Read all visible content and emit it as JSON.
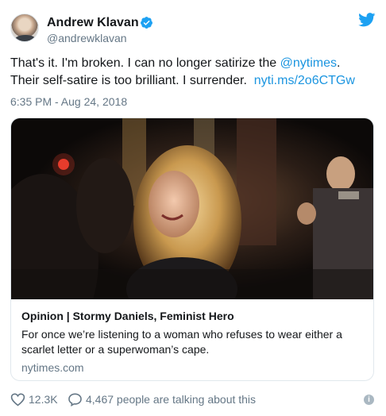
{
  "author": {
    "name": "Andrew Klavan",
    "handle": "@andrewklavan",
    "avatar_icon": "avatar-photo",
    "verified_icon": "verified-badge-icon"
  },
  "tweet": {
    "text_before": "That's it. I'm broken. I can no longer satirize the ",
    "mention": "@nytimes",
    "text_after": ".\nTheir self-satire is too brilliant. I surrender.  ",
    "link": "nyti.ms/2o6CTGw",
    "timestamp": "6:35 PM - Aug 24, 2018"
  },
  "card": {
    "title": "Opinion | Stormy Daniels, Feminist Hero",
    "description": "For once we’re listening to a woman who refuses to wear either a scarlet letter or a superwoman’s cape.",
    "domain": "nytimes.com",
    "image_icon": "article-photo"
  },
  "footer": {
    "likes": "12.3K",
    "talking": "4,467 people are talking about this",
    "info_glyph": "i"
  },
  "colors": {
    "link": "#1b95e0",
    "secondary_text": "#657786",
    "border": "#e1e8ed"
  }
}
